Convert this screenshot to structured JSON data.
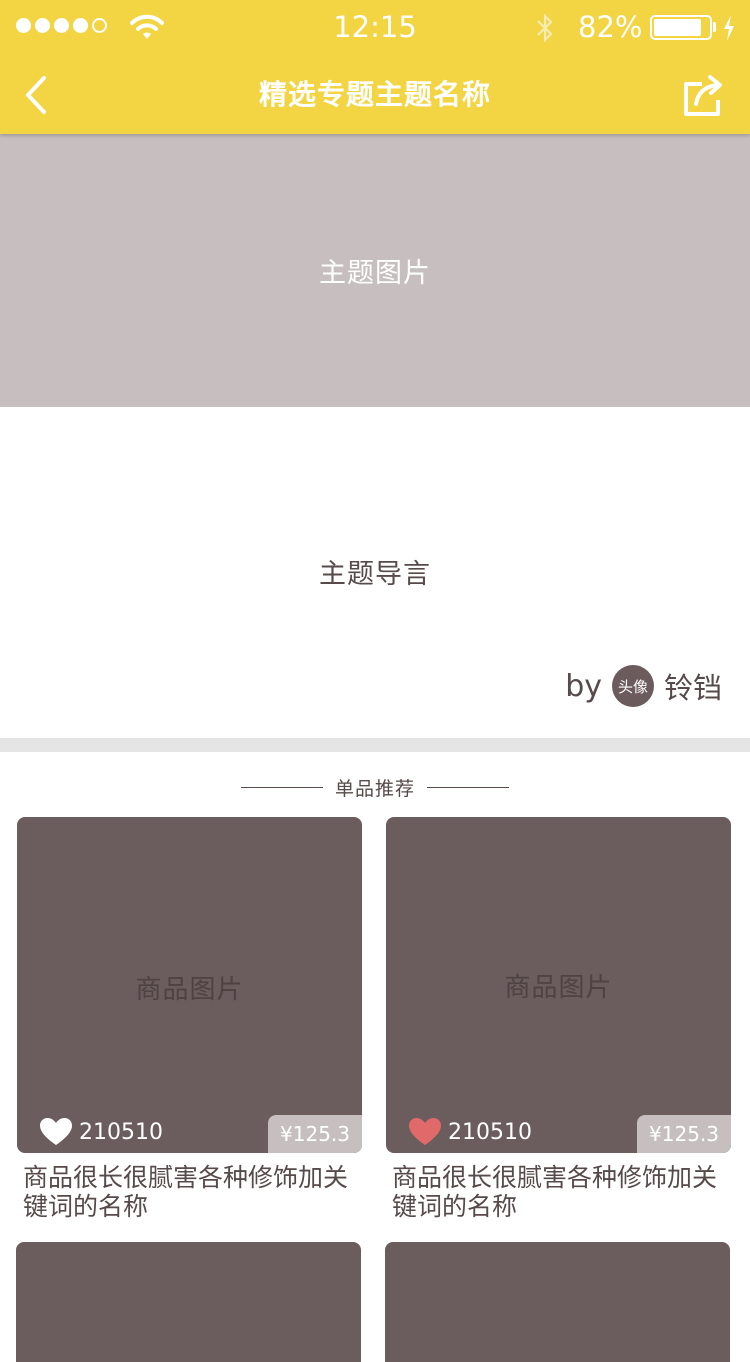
{
  "status_bar": {
    "time": "12:15",
    "battery": "82%"
  },
  "nav": {
    "title": "精选专题主题名称",
    "back_icon": "chevron-left-icon",
    "share_icon": "share-icon"
  },
  "hero": {
    "label": "主题图片"
  },
  "intro": {
    "text": "主题导言",
    "by": "by",
    "avatar_label": "头像",
    "author": "铃铛"
  },
  "section": {
    "title": "单品推荐"
  },
  "products": [
    {
      "image_label": "商品图片",
      "likes": "210510",
      "liked": false,
      "price": "¥125.3",
      "name": "商品很长很腻害各种修饰加关键词的名称"
    },
    {
      "image_label": "商品图片",
      "likes": "210510",
      "liked": true,
      "price": "¥125.3",
      "name": "商品很长很腻害各种修饰加关键词的名称"
    }
  ],
  "colors": {
    "header": "#f3d443",
    "hero": "#c7bfbf",
    "card": "#6b5c5d",
    "text": "#574a4a",
    "liked_heart": "#e06a6a"
  }
}
